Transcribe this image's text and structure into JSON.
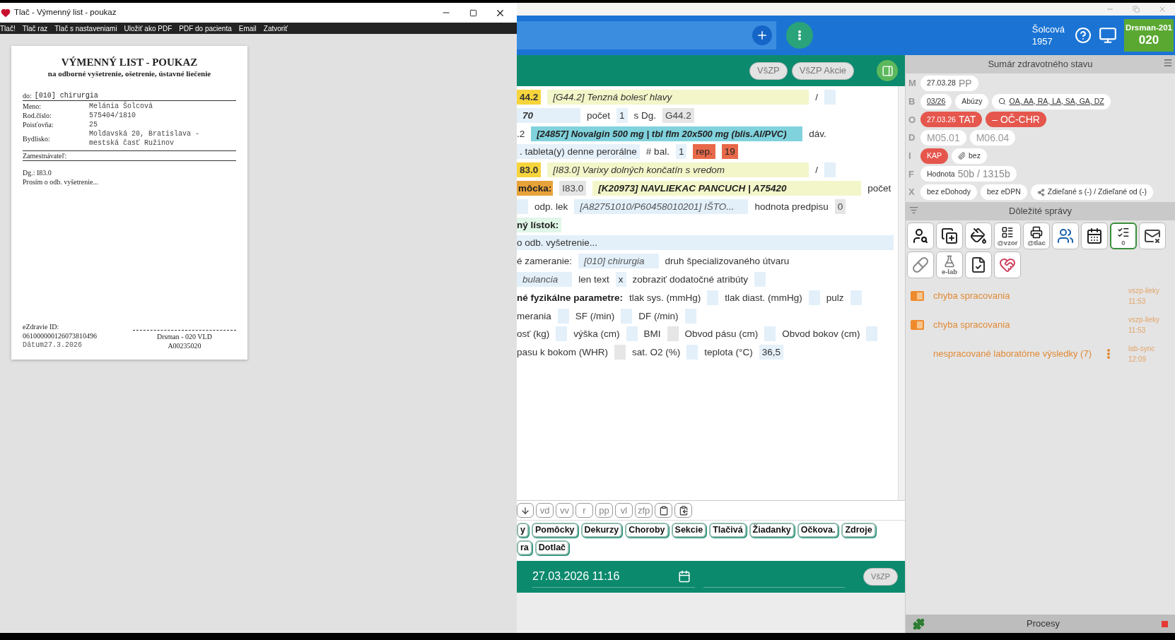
{
  "print_window": {
    "title": "Tlač - Výmenný list - poukaz",
    "menu": [
      "Tlač!",
      "Tlač raz",
      "Tlač s nastaveniami",
      "Uložiť ako PDF",
      "PDF do pacienta",
      "Email",
      "Zatvoriť"
    ],
    "document": {
      "title": "VÝMENNÝ LIST - POUKAZ",
      "subtitle": "na odborné vyšetrenie, ošetrenie, ústavné liečenie",
      "recipient_label": "do:",
      "recipient": "[010] chirurgia",
      "fields": [
        {
          "label": "Meno:",
          "value": "Melánia Šolcová"
        },
        {
          "label": "Rod.číslo:",
          "value": "575404/1810"
        },
        {
          "label": "Poisťovňa:",
          "value": "25"
        },
        {
          "label": "Bydlisko:",
          "value": "Moldavská 20, Bratislava - mestská časť Ružinov"
        }
      ],
      "employer_label": "Zamestnávateľ:",
      "diagnosis": "Dg.: I83.0",
      "request": "Prosím o odb. vyšetrenie...",
      "ezdravie_label": "eZdravie ID:",
      "ezdravie_id": "061000000126073810496",
      "date_label": "Dátum",
      "date": "27.3.2026",
      "signature": "Drsman - 020 VLD",
      "signature_code": "A00235020"
    }
  },
  "app": {
    "header": {
      "patient_name": "Šolcová",
      "patient_year": "1957",
      "user": "Drsman-201",
      "user_code": "020"
    },
    "toolbar_buttons": [
      "VšZP",
      "VšZP Akcie"
    ],
    "form_rows": [
      [
        {
          "kind": "code",
          "text": "44.2"
        },
        {
          "kind": "diagnosis",
          "text": "[G44.2] Tenzná bolesť hlavy"
        },
        {
          "kind": "label",
          "text": "/"
        },
        {
          "kind": "empty"
        }
      ],
      [
        {
          "kind": "field_wide",
          "text": "70"
        },
        {
          "kind": "label",
          "text": "počet"
        },
        {
          "kind": "field",
          "text": "1"
        },
        {
          "kind": "label",
          "text": "s Dg."
        },
        {
          "kind": "grey",
          "text": "G44.2"
        }
      ],
      [
        {
          "kind": "label",
          "text": ".2"
        },
        {
          "kind": "drug",
          "text": "[24857] Novalgin 500 mg | tbl flm 20x500 mg (blis.Al/PVC)"
        },
        {
          "kind": "label",
          "text": "dáv."
        }
      ],
      [
        {
          "kind": "field",
          "text": ". tableta(y) denne perorálne"
        },
        {
          "kind": "label",
          "text": "# bal."
        },
        {
          "kind": "field",
          "text": "1"
        },
        {
          "kind": "alert",
          "text": "rep."
        },
        {
          "kind": "alert",
          "text": "19"
        }
      ],
      [
        {
          "kind": "code",
          "text": "83.0"
        },
        {
          "kind": "diagnosis",
          "text": "[I83.0] Varixy dolných končatín s vredom"
        },
        {
          "kind": "label",
          "text": "/"
        },
        {
          "kind": "empty"
        }
      ],
      [
        {
          "kind": "tag",
          "text": "môcka:"
        },
        {
          "kind": "grey",
          "text": "I83.0"
        },
        {
          "kind": "product",
          "text": "[K20973] NAVLIEKAC PANCUCH | A75420"
        },
        {
          "kind": "label",
          "text": "počet"
        }
      ],
      [
        {
          "kind": "empty"
        },
        {
          "kind": "label",
          "text": "odp. lek"
        },
        {
          "kind": "field_italic",
          "text": "[A82751010/P60458010201] IŠTO..."
        },
        {
          "kind": "label",
          "text": "hodnota predpisu"
        },
        {
          "kind": "grey",
          "text": "0"
        }
      ],
      [
        {
          "kind": "heading",
          "text": "ný lístok:"
        }
      ],
      [
        {
          "kind": "note",
          "text": "o odb. vyšetrenie..."
        }
      ],
      [
        {
          "kind": "label",
          "text": "é zameranie:"
        },
        {
          "kind": "field_italic",
          "text": "[010] chirurgia"
        },
        {
          "kind": "label",
          "text": "druh špecializovaného útvaru"
        }
      ],
      [
        {
          "kind": "field_italic",
          "text": "bulancia"
        },
        {
          "kind": "label",
          "text": "len text"
        },
        {
          "kind": "field",
          "text": "x"
        },
        {
          "kind": "label",
          "text": "zobraziť dodatočné atribúty"
        },
        {
          "kind": "empty"
        }
      ],
      [
        {
          "kind": "bold",
          "text": "né fyzikálne parametre:"
        },
        {
          "kind": "label",
          "text": "tlak sys. (mmHg)"
        },
        {
          "kind": "empty"
        },
        {
          "kind": "label",
          "text": "tlak diast. (mmHg)"
        },
        {
          "kind": "empty"
        },
        {
          "kind": "label",
          "text": "pulz"
        },
        {
          "kind": "empty"
        }
      ],
      [
        {
          "kind": "label",
          "text": "merania"
        },
        {
          "kind": "empty"
        },
        {
          "kind": "label",
          "text": "SF (/min)"
        },
        {
          "kind": "empty"
        },
        {
          "kind": "label",
          "text": "DF (/min)"
        },
        {
          "kind": "empty"
        }
      ],
      [
        {
          "kind": "label",
          "text": "osť (kg)"
        },
        {
          "kind": "empty"
        },
        {
          "kind": "label",
          "text": "výška (cm)"
        },
        {
          "kind": "empty"
        },
        {
          "kind": "label",
          "text": "BMI"
        },
        {
          "kind": "empty_grey"
        },
        {
          "kind": "label",
          "text": "Obvod pásu (cm)"
        },
        {
          "kind": "empty"
        },
        {
          "kind": "label",
          "text": "Obvod bokov (cm)"
        },
        {
          "kind": "empty"
        }
      ],
      [
        {
          "kind": "label",
          "text": "pasu k bokom (WHR)"
        },
        {
          "kind": "empty_grey"
        },
        {
          "kind": "label",
          "text": "sat. O2 (%)"
        },
        {
          "kind": "empty"
        },
        {
          "kind": "label",
          "text": "teplota (°C)"
        },
        {
          "kind": "field",
          "text": "36,5"
        }
      ]
    ],
    "edit_buttons": [
      "vd",
      "vv",
      "r",
      "pp",
      "vl",
      "zfp"
    ],
    "tab_rows": [
      [
        {
          "label": "y",
          "selected": false
        },
        {
          "label": "Pomôcky",
          "selected": false
        },
        {
          "label": "Dekurzy",
          "selected": false
        },
        {
          "label": "Choroby",
          "selected": false
        },
        {
          "label": "Sekcie",
          "selected": false
        },
        {
          "label": "Tlačivá",
          "selected": false
        },
        {
          "label": "Žiadanky",
          "selected": false
        },
        {
          "label": "Očkova.",
          "selected": false
        },
        {
          "label": "Zdroje",
          "selected": false
        }
      ],
      [
        {
          "label": "ra",
          "selected": false
        },
        {
          "label": "Dotlač",
          "selected": false
        }
      ]
    ],
    "date": "27.03.2026 11:16",
    "date_button": "VšZP",
    "summary": {
      "title": "Sumár zdravotného stavu",
      "rows": [
        {
          "letter": "M",
          "chips": [
            {
              "kind": "plain",
              "small": "27.03.28",
              "large": "PP"
            }
          ]
        },
        {
          "letter": "B",
          "chips": [
            {
              "kind": "link",
              "small": "03/26"
            },
            {
              "kind": "plain",
              "small": "Abúzy"
            },
            {
              "kind": "search-link",
              "small": "OA, AA, RA, LA, SA, GA, DZ"
            }
          ]
        },
        {
          "letter": "O",
          "chips": [
            {
              "kind": "red",
              "small": "27.03.26",
              "large": "TAT"
            },
            {
              "kind": "red",
              "large": "– OČ-CHR"
            }
          ]
        },
        {
          "letter": "D",
          "chips": [
            {
              "kind": "faded",
              "large": "M05.01"
            },
            {
              "kind": "faded",
              "large": "M06.04"
            }
          ]
        },
        {
          "letter": "I",
          "chips": [
            {
              "kind": "red",
              "small": "KAP"
            },
            {
              "kind": "attachment",
              "small": "bez"
            }
          ]
        },
        {
          "letter": "F",
          "chips": [
            {
              "kind": "plain",
              "small": "Hodnota",
              "large": "50b / 1315b"
            }
          ]
        },
        {
          "letter": "X",
          "chips": [
            {
              "kind": "plain",
              "small": "bez eDohody"
            },
            {
              "kind": "plain",
              "small": "bez eDPN"
            },
            {
              "kind": "shared",
              "small": "Zdieľané s (-) / Zdieľané od (-)"
            }
          ]
        }
      ]
    },
    "messages": {
      "title": "Dôležité správy",
      "tiles": [
        {
          "kind": "person-search"
        },
        {
          "kind": "copy-plus"
        },
        {
          "kind": "paint"
        },
        {
          "kind": "template",
          "label": "@vzor"
        },
        {
          "kind": "print",
          "label": "@tlac"
        },
        {
          "kind": "people"
        },
        {
          "kind": "calendar"
        },
        {
          "kind": "checklist",
          "label": "0"
        },
        {
          "kind": "mail-x"
        },
        {
          "kind": "pills"
        },
        {
          "kind": "flask",
          "label": "e-lab"
        },
        {
          "kind": "document-check"
        },
        {
          "kind": "heart"
        }
      ],
      "items": [
        {
          "kind": "error",
          "text": "chyba spracovania",
          "source": "vszp-lieky",
          "time": "11:53"
        },
        {
          "kind": "error",
          "text": "chyba spracovania",
          "source": "vszp-lieky",
          "time": "11:53"
        },
        {
          "kind": "lab",
          "text": "nespracované laboratórne výsledky (7)",
          "source": "lab-sync",
          "time": "12:09"
        }
      ]
    },
    "footer": "Procesy"
  }
}
